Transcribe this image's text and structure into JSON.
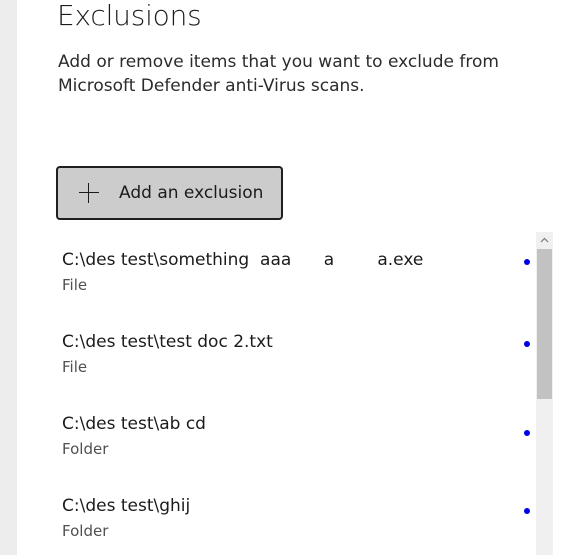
{
  "page": {
    "title": "Exclusions",
    "description": "Add or remove items that you want to exclude from Microsoft Defender anti-Virus scans."
  },
  "add_button": {
    "icon": "plus-icon",
    "label": "Add an exclusion"
  },
  "exclusions": [
    {
      "path": "C:\\des test\\something  aaa      a        a.exe",
      "type": "File"
    },
    {
      "path": "C:\\des test\\test doc 2.txt",
      "type": "File"
    },
    {
      "path": "C:\\des test\\ab cd",
      "type": "Folder"
    },
    {
      "path": "C:\\des test\\ghij",
      "type": "Folder"
    }
  ],
  "colors": {
    "accent_dot": "#0000e6",
    "button_bg": "#cccccc",
    "button_border": "#1f1f1f"
  }
}
